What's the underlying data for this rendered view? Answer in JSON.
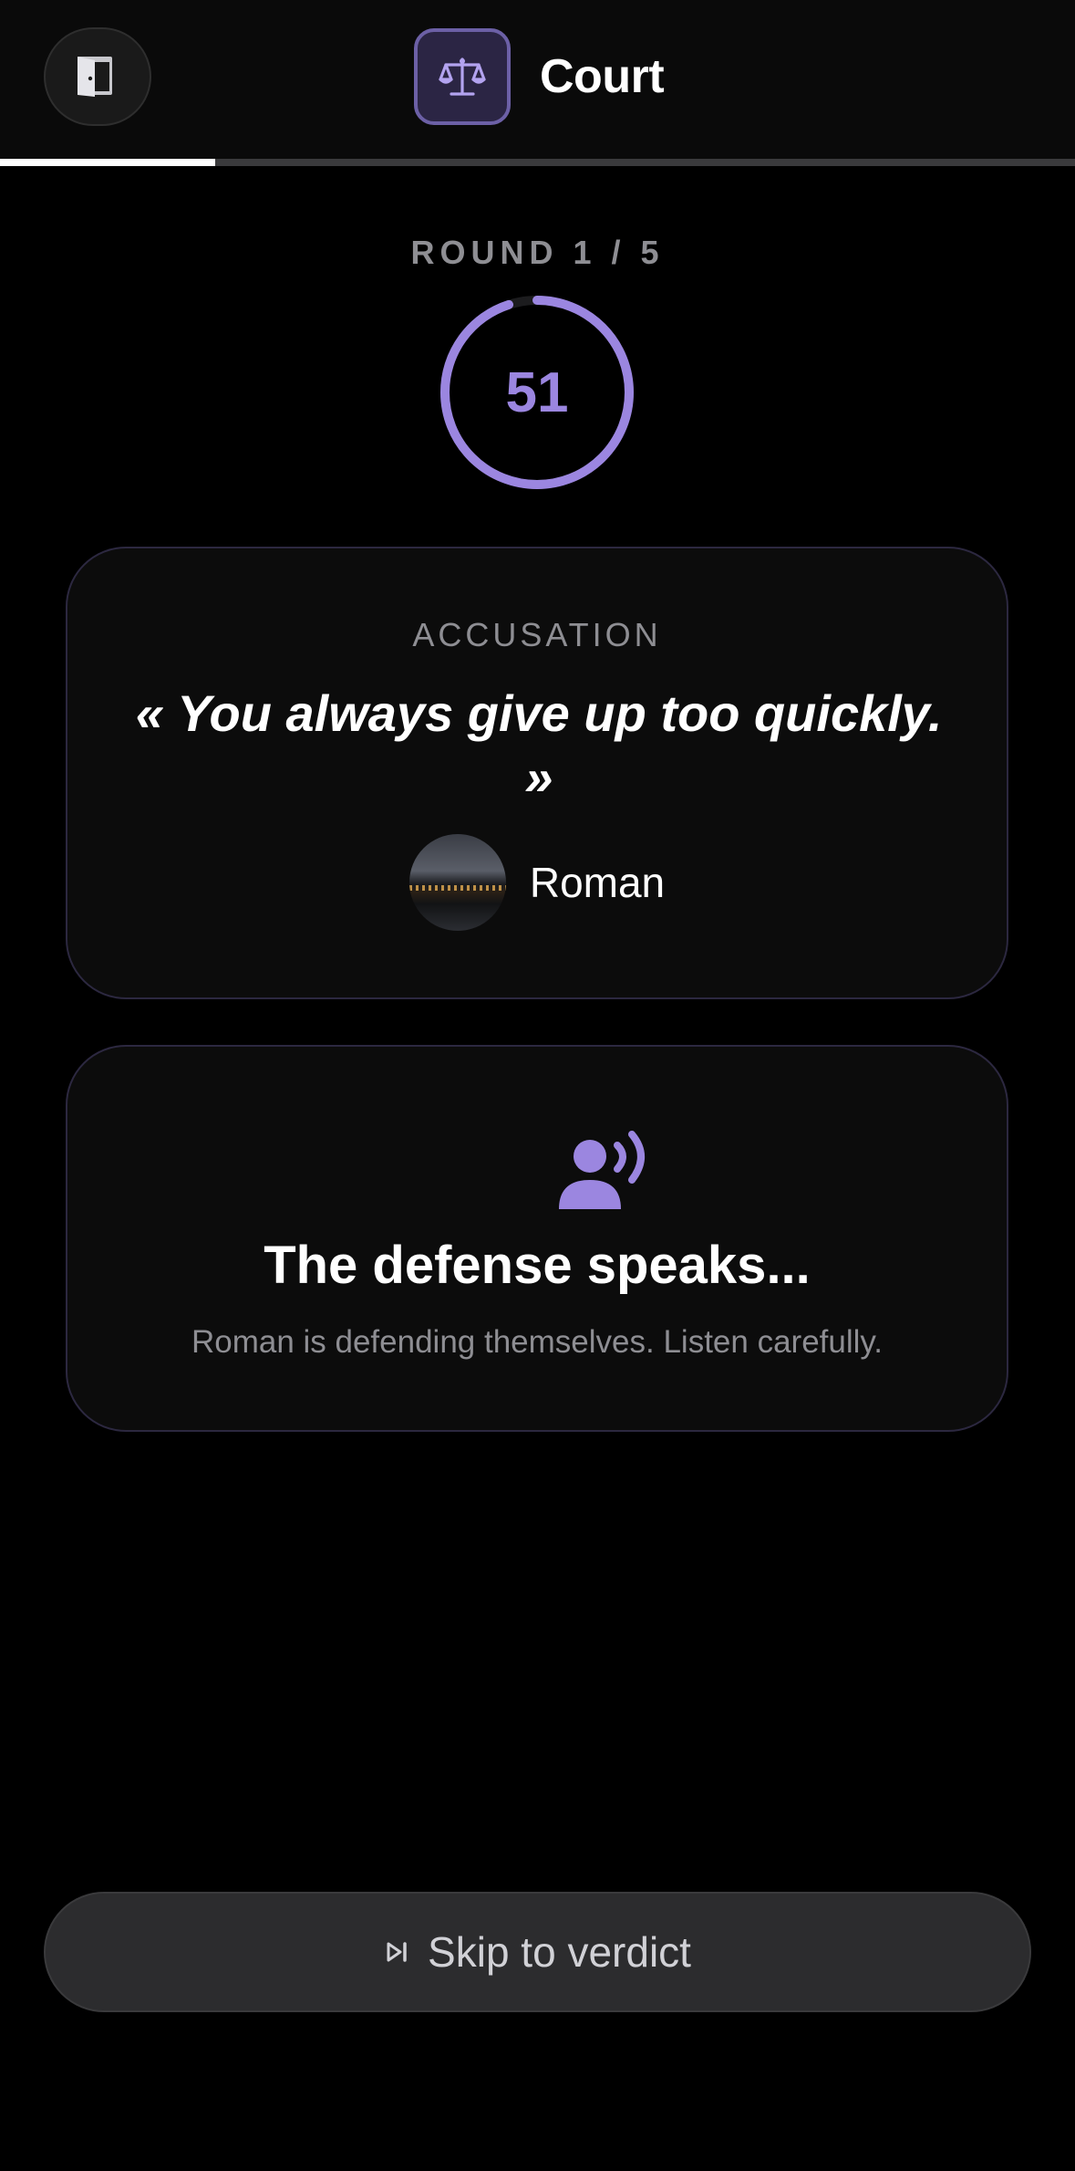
{
  "header": {
    "title": "Court",
    "progress_fraction": 0.2
  },
  "round": {
    "label": "ROUND 1 / 5",
    "timer_value": "51",
    "timer_fraction": 0.95
  },
  "accusation": {
    "label": "ACCUSATION",
    "quote": "« You always give up too quickly. »",
    "author": "Roman"
  },
  "defense": {
    "title": "The defense speaks...",
    "text": "Roman is defending themselves. Listen carefully."
  },
  "skip_button": {
    "label": "Skip to verdict"
  },
  "icons": {
    "exit": "door-exit-icon",
    "logo": "scale-balance-icon",
    "defense": "person-speaking-icon",
    "skip": "skip-forward-icon"
  },
  "colors": {
    "accent": "#9b86e0",
    "background": "#000000",
    "card_border": "#2c2840",
    "muted_text": "#8e8e93"
  }
}
